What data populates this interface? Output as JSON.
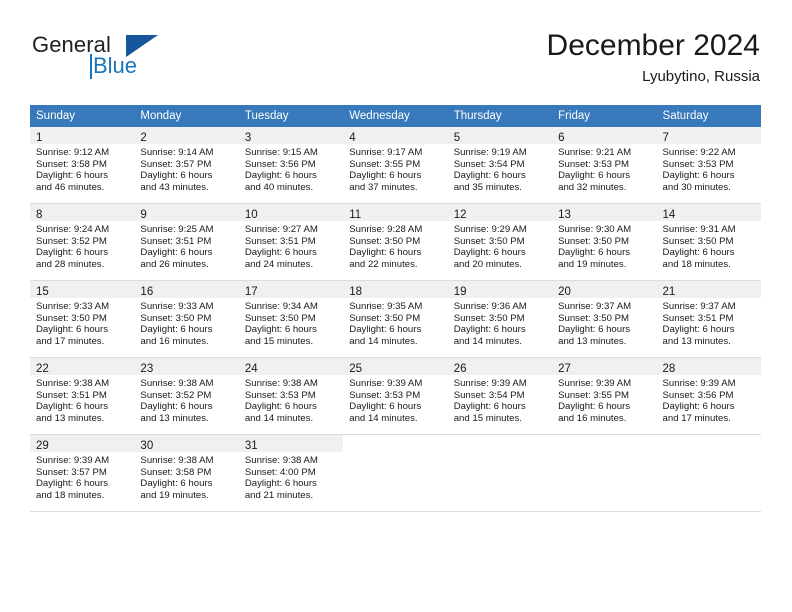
{
  "brand": {
    "name_part1": "General",
    "name_part2": "Blue",
    "logo_icon": "triangle-logo-icon"
  },
  "header": {
    "month_title": "December 2024",
    "location": "Lyubytino, Russia"
  },
  "calendar": {
    "weekday_headers": [
      "Sunday",
      "Monday",
      "Tuesday",
      "Wednesday",
      "Thursday",
      "Friday",
      "Saturday"
    ],
    "accent_color": "#3879bb",
    "daynum_band_color": "#f0f0f0",
    "weeks": [
      [
        {
          "day": "1",
          "sunrise": "Sunrise: 9:12 AM",
          "sunset": "Sunset: 3:58 PM",
          "daylight_line1": "Daylight: 6 hours",
          "daylight_line2": "and 46 minutes."
        },
        {
          "day": "2",
          "sunrise": "Sunrise: 9:14 AM",
          "sunset": "Sunset: 3:57 PM",
          "daylight_line1": "Daylight: 6 hours",
          "daylight_line2": "and 43 minutes."
        },
        {
          "day": "3",
          "sunrise": "Sunrise: 9:15 AM",
          "sunset": "Sunset: 3:56 PM",
          "daylight_line1": "Daylight: 6 hours",
          "daylight_line2": "and 40 minutes."
        },
        {
          "day": "4",
          "sunrise": "Sunrise: 9:17 AM",
          "sunset": "Sunset: 3:55 PM",
          "daylight_line1": "Daylight: 6 hours",
          "daylight_line2": "and 37 minutes."
        },
        {
          "day": "5",
          "sunrise": "Sunrise: 9:19 AM",
          "sunset": "Sunset: 3:54 PM",
          "daylight_line1": "Daylight: 6 hours",
          "daylight_line2": "and 35 minutes."
        },
        {
          "day": "6",
          "sunrise": "Sunrise: 9:21 AM",
          "sunset": "Sunset: 3:53 PM",
          "daylight_line1": "Daylight: 6 hours",
          "daylight_line2": "and 32 minutes."
        },
        {
          "day": "7",
          "sunrise": "Sunrise: 9:22 AM",
          "sunset": "Sunset: 3:53 PM",
          "daylight_line1": "Daylight: 6 hours",
          "daylight_line2": "and 30 minutes."
        }
      ],
      [
        {
          "day": "8",
          "sunrise": "Sunrise: 9:24 AM",
          "sunset": "Sunset: 3:52 PM",
          "daylight_line1": "Daylight: 6 hours",
          "daylight_line2": "and 28 minutes."
        },
        {
          "day": "9",
          "sunrise": "Sunrise: 9:25 AM",
          "sunset": "Sunset: 3:51 PM",
          "daylight_line1": "Daylight: 6 hours",
          "daylight_line2": "and 26 minutes."
        },
        {
          "day": "10",
          "sunrise": "Sunrise: 9:27 AM",
          "sunset": "Sunset: 3:51 PM",
          "daylight_line1": "Daylight: 6 hours",
          "daylight_line2": "and 24 minutes."
        },
        {
          "day": "11",
          "sunrise": "Sunrise: 9:28 AM",
          "sunset": "Sunset: 3:50 PM",
          "daylight_line1": "Daylight: 6 hours",
          "daylight_line2": "and 22 minutes."
        },
        {
          "day": "12",
          "sunrise": "Sunrise: 9:29 AM",
          "sunset": "Sunset: 3:50 PM",
          "daylight_line1": "Daylight: 6 hours",
          "daylight_line2": "and 20 minutes."
        },
        {
          "day": "13",
          "sunrise": "Sunrise: 9:30 AM",
          "sunset": "Sunset: 3:50 PM",
          "daylight_line1": "Daylight: 6 hours",
          "daylight_line2": "and 19 minutes."
        },
        {
          "day": "14",
          "sunrise": "Sunrise: 9:31 AM",
          "sunset": "Sunset: 3:50 PM",
          "daylight_line1": "Daylight: 6 hours",
          "daylight_line2": "and 18 minutes."
        }
      ],
      [
        {
          "day": "15",
          "sunrise": "Sunrise: 9:33 AM",
          "sunset": "Sunset: 3:50 PM",
          "daylight_line1": "Daylight: 6 hours",
          "daylight_line2": "and 17 minutes."
        },
        {
          "day": "16",
          "sunrise": "Sunrise: 9:33 AM",
          "sunset": "Sunset: 3:50 PM",
          "daylight_line1": "Daylight: 6 hours",
          "daylight_line2": "and 16 minutes."
        },
        {
          "day": "17",
          "sunrise": "Sunrise: 9:34 AM",
          "sunset": "Sunset: 3:50 PM",
          "daylight_line1": "Daylight: 6 hours",
          "daylight_line2": "and 15 minutes."
        },
        {
          "day": "18",
          "sunrise": "Sunrise: 9:35 AM",
          "sunset": "Sunset: 3:50 PM",
          "daylight_line1": "Daylight: 6 hours",
          "daylight_line2": "and 14 minutes."
        },
        {
          "day": "19",
          "sunrise": "Sunrise: 9:36 AM",
          "sunset": "Sunset: 3:50 PM",
          "daylight_line1": "Daylight: 6 hours",
          "daylight_line2": "and 14 minutes."
        },
        {
          "day": "20",
          "sunrise": "Sunrise: 9:37 AM",
          "sunset": "Sunset: 3:50 PM",
          "daylight_line1": "Daylight: 6 hours",
          "daylight_line2": "and 13 minutes."
        },
        {
          "day": "21",
          "sunrise": "Sunrise: 9:37 AM",
          "sunset": "Sunset: 3:51 PM",
          "daylight_line1": "Daylight: 6 hours",
          "daylight_line2": "and 13 minutes."
        }
      ],
      [
        {
          "day": "22",
          "sunrise": "Sunrise: 9:38 AM",
          "sunset": "Sunset: 3:51 PM",
          "daylight_line1": "Daylight: 6 hours",
          "daylight_line2": "and 13 minutes."
        },
        {
          "day": "23",
          "sunrise": "Sunrise: 9:38 AM",
          "sunset": "Sunset: 3:52 PM",
          "daylight_line1": "Daylight: 6 hours",
          "daylight_line2": "and 13 minutes."
        },
        {
          "day": "24",
          "sunrise": "Sunrise: 9:38 AM",
          "sunset": "Sunset: 3:53 PM",
          "daylight_line1": "Daylight: 6 hours",
          "daylight_line2": "and 14 minutes."
        },
        {
          "day": "25",
          "sunrise": "Sunrise: 9:39 AM",
          "sunset": "Sunset: 3:53 PM",
          "daylight_line1": "Daylight: 6 hours",
          "daylight_line2": "and 14 minutes."
        },
        {
          "day": "26",
          "sunrise": "Sunrise: 9:39 AM",
          "sunset": "Sunset: 3:54 PM",
          "daylight_line1": "Daylight: 6 hours",
          "daylight_line2": "and 15 minutes."
        },
        {
          "day": "27",
          "sunrise": "Sunrise: 9:39 AM",
          "sunset": "Sunset: 3:55 PM",
          "daylight_line1": "Daylight: 6 hours",
          "daylight_line2": "and 16 minutes."
        },
        {
          "day": "28",
          "sunrise": "Sunrise: 9:39 AM",
          "sunset": "Sunset: 3:56 PM",
          "daylight_line1": "Daylight: 6 hours",
          "daylight_line2": "and 17 minutes."
        }
      ],
      [
        {
          "day": "29",
          "sunrise": "Sunrise: 9:39 AM",
          "sunset": "Sunset: 3:57 PM",
          "daylight_line1": "Daylight: 6 hours",
          "daylight_line2": "and 18 minutes."
        },
        {
          "day": "30",
          "sunrise": "Sunrise: 9:38 AM",
          "sunset": "Sunset: 3:58 PM",
          "daylight_line1": "Daylight: 6 hours",
          "daylight_line2": "and 19 minutes."
        },
        {
          "day": "31",
          "sunrise": "Sunrise: 9:38 AM",
          "sunset": "Sunset: 4:00 PM",
          "daylight_line1": "Daylight: 6 hours",
          "daylight_line2": "and 21 minutes."
        },
        {
          "day": "",
          "sunrise": "",
          "sunset": "",
          "daylight_line1": "",
          "daylight_line2": ""
        },
        {
          "day": "",
          "sunrise": "",
          "sunset": "",
          "daylight_line1": "",
          "daylight_line2": ""
        },
        {
          "day": "",
          "sunrise": "",
          "sunset": "",
          "daylight_line1": "",
          "daylight_line2": ""
        },
        {
          "day": "",
          "sunrise": "",
          "sunset": "",
          "daylight_line1": "",
          "daylight_line2": ""
        }
      ]
    ]
  }
}
